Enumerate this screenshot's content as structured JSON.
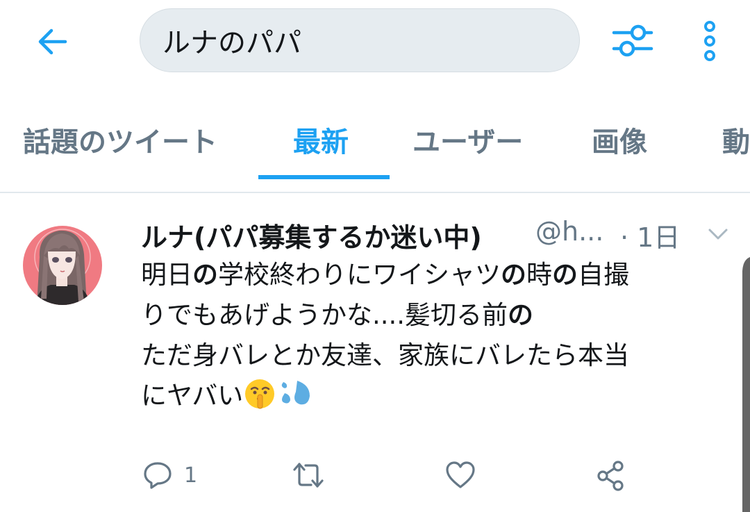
{
  "header": {
    "search_query": "ルナのパパ",
    "back_icon": "arrow-left-icon",
    "filter_icon": "sliders-icon",
    "more_icon": "vertical-dots-icon",
    "accent_color": "#1da1f2"
  },
  "tabs": [
    {
      "label": "話題のツイート",
      "active": false
    },
    {
      "label": "最新",
      "active": true
    },
    {
      "label": "ユーザー",
      "active": false
    },
    {
      "label": "画像",
      "active": false
    },
    {
      "label": "動",
      "active": false
    }
  ],
  "tweet": {
    "display_name": "ルナ(パパ募集するか迷い中)",
    "handle": "@h...",
    "time": "· 1日",
    "lines": [
      {
        "a": "明日",
        "b": "の",
        "c": "学校終わりにワイシャツ",
        "d": "の",
        "e": "時",
        "f": "の",
        "g": "自撮"
      },
      {
        "a": "りでもあげようかな....髪切る前",
        "b": "の"
      },
      {
        "a": "ただ身バレとか友達、家族にバレたら本当"
      },
      {
        "a": "にヤバい"
      }
    ],
    "emojis": [
      "shushing-face-emoji",
      "sweat-droplets-emoji"
    ],
    "reply_count": "1",
    "retweet_count": "",
    "like_count": ""
  }
}
